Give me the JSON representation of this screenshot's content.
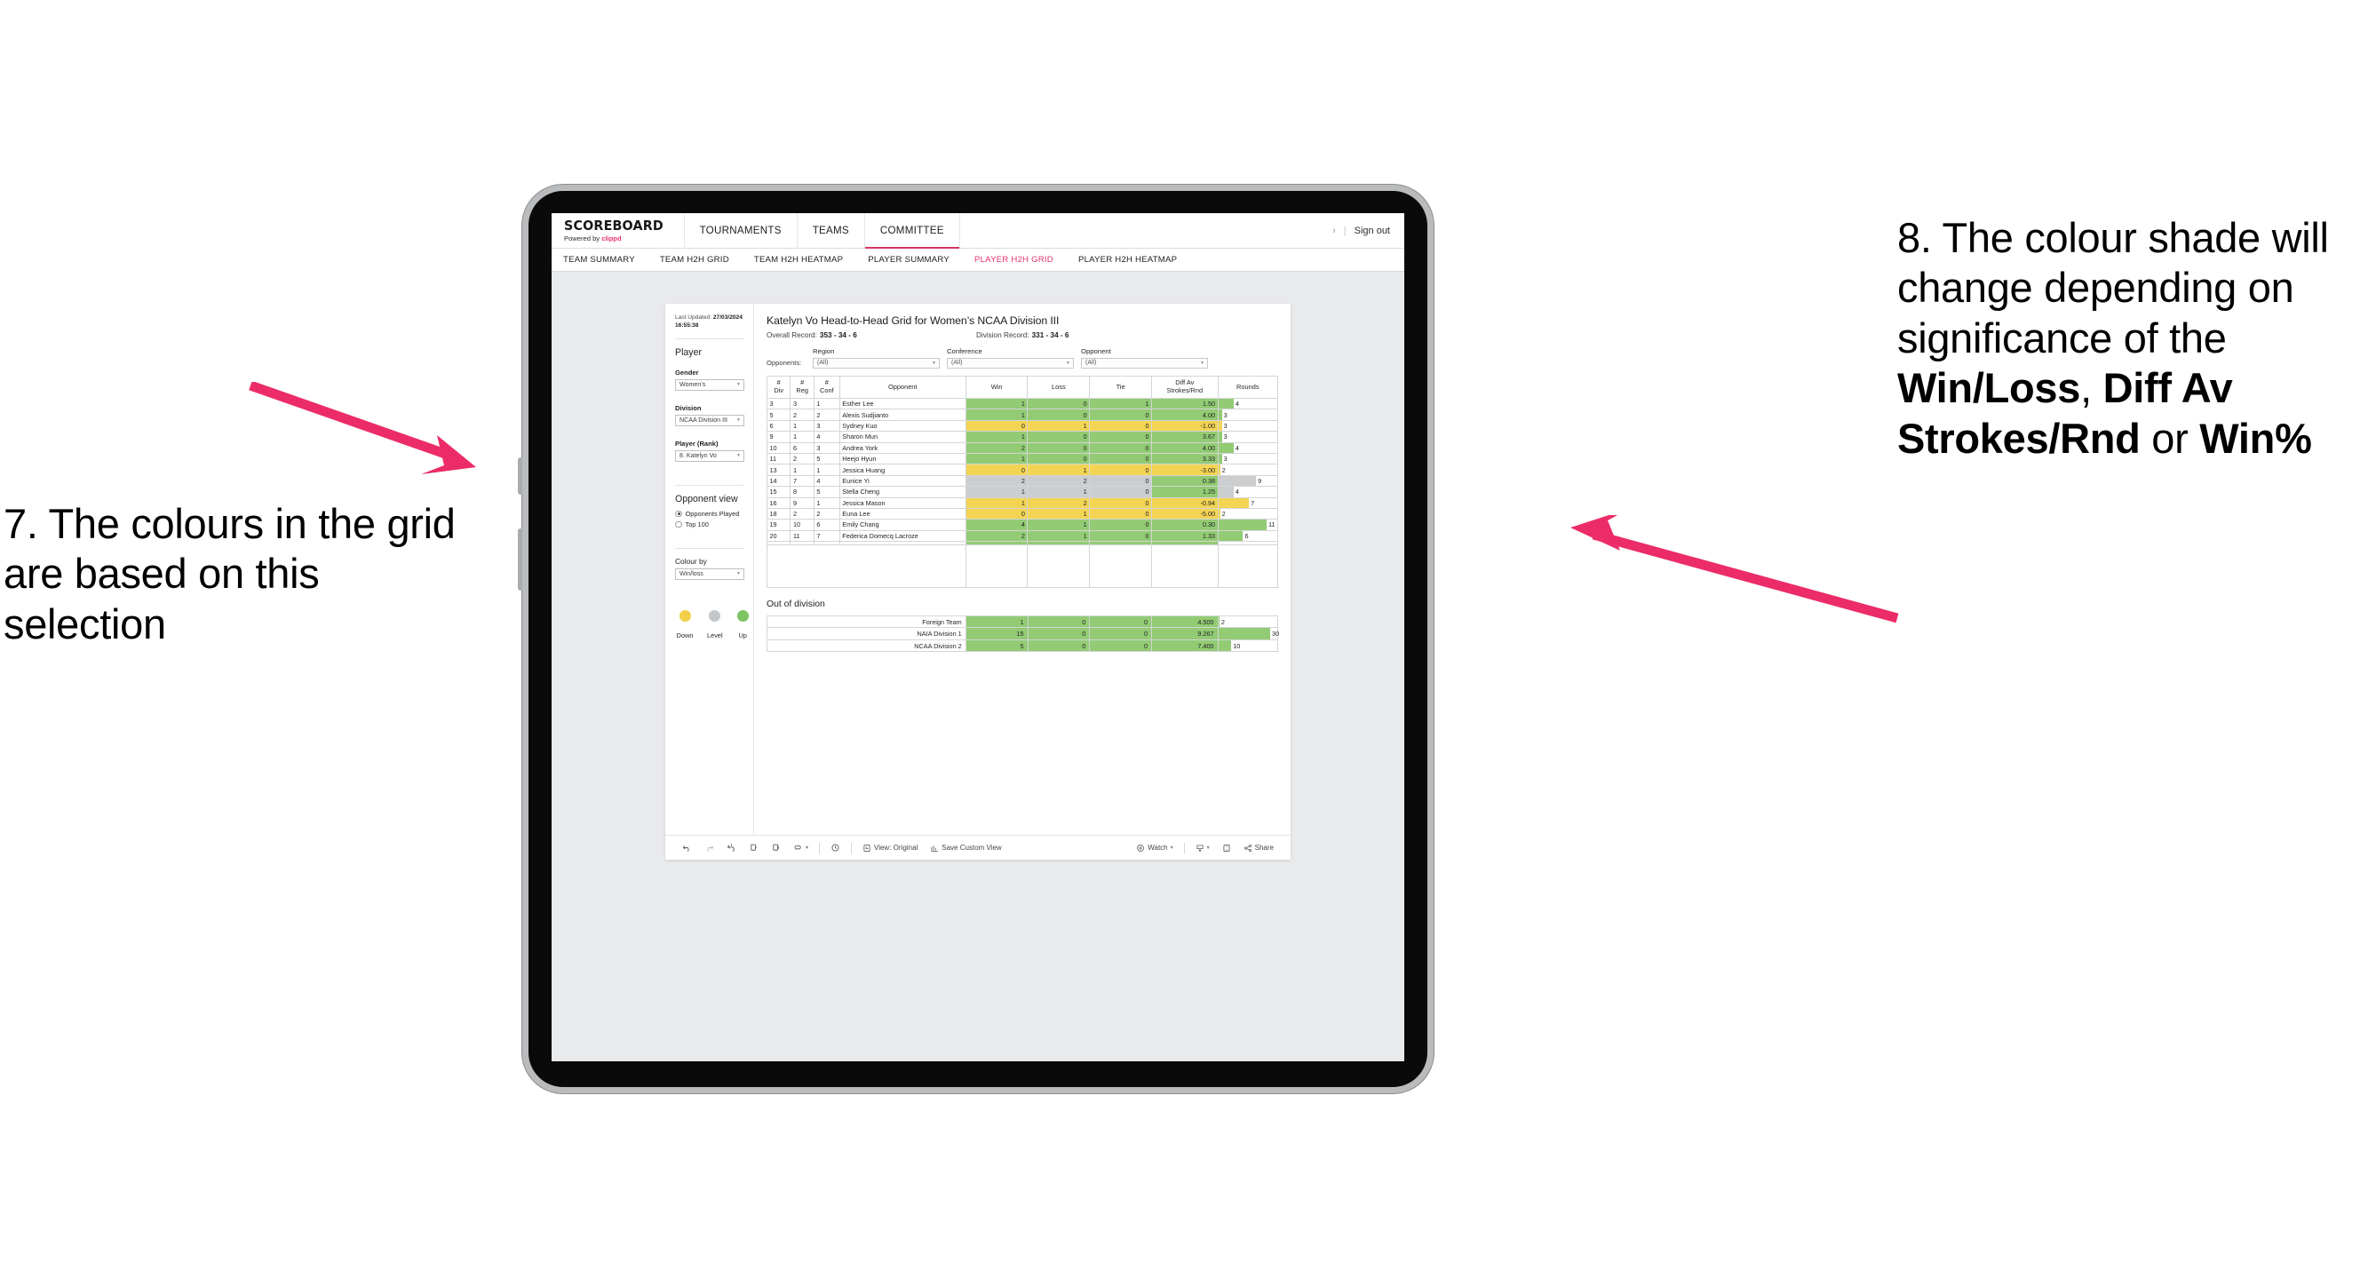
{
  "annotations": {
    "left": {
      "text": "7. The colours in the grid are based on this selection",
      "arrow_color": "#ec2c68"
    },
    "right": {
      "prefix": "8. The colour shade will change depending on significance of the ",
      "bold1": "Win/Loss",
      "mid1": ", ",
      "bold2": "Diff Av Strokes/Rnd",
      "mid2": " or ",
      "bold3": "Win%",
      "arrow_color": "#ec2c68"
    }
  },
  "header": {
    "logo": "SCOREBOARD",
    "powered_prefix": "Powered by ",
    "powered_brand": "clippd",
    "nav": [
      {
        "label": "TOURNAMENTS",
        "active": false
      },
      {
        "label": "TEAMS",
        "active": false
      },
      {
        "label": "COMMITTEE",
        "active": true
      }
    ],
    "chevron": "›",
    "divider": "|",
    "sign_out": "Sign out"
  },
  "subnav": [
    {
      "label": "TEAM SUMMARY",
      "active": false
    },
    {
      "label": "TEAM H2H GRID",
      "active": false
    },
    {
      "label": "TEAM H2H HEATMAP",
      "active": false
    },
    {
      "label": "PLAYER SUMMARY",
      "active": false
    },
    {
      "label": "PLAYER H2H GRID",
      "active": true
    },
    {
      "label": "PLAYER H2H HEATMAP",
      "active": false
    }
  ],
  "filters": {
    "last_updated_label": "Last Updated: ",
    "last_updated_value": "27/03/2024 16:55:38",
    "player_heading": "Player",
    "gender": {
      "label": "Gender",
      "value": "Women’s"
    },
    "division": {
      "label": "Division",
      "value": "NCAA Division III"
    },
    "player_rank": {
      "label": "Player (Rank)",
      "value": "8. Katelyn Vo"
    },
    "opponent_view": {
      "heading": "Opponent view",
      "options": [
        {
          "label": "Opponents Played",
          "selected": true
        },
        {
          "label": "Top 100",
          "selected": false
        }
      ]
    },
    "colour_by": {
      "label": "Colour by",
      "value": "Win/loss"
    },
    "legend": [
      {
        "label": "Down",
        "color": "#f2d04b"
      },
      {
        "label": "Level",
        "color": "#c3c7ca"
      },
      {
        "label": "Up",
        "color": "#7dc462"
      }
    ]
  },
  "main": {
    "title": "Katelyn Vo Head-to-Head Grid for Women’s NCAA Division III",
    "overall_record_label": "Overall Record:",
    "overall_record_value": "353 -  34 - 6",
    "division_record_label": "Division Record:",
    "division_record_value": "331 -  34 - 6",
    "opponents_label": "Opponents:",
    "opponent_filters": [
      {
        "title": "Region",
        "value": "(All)"
      },
      {
        "title": "Conference",
        "value": "(All)"
      },
      {
        "title": "Opponent",
        "value": "(All)"
      }
    ],
    "columns": [
      {
        "line1": "#",
        "line2": "Div"
      },
      {
        "line1": "#",
        "line2": "Reg"
      },
      {
        "line1": "#",
        "line2": "Conf"
      },
      {
        "line1": "Opponent",
        "line2": ""
      },
      {
        "line1": "Win",
        "line2": ""
      },
      {
        "line1": "Loss",
        "line2": ""
      },
      {
        "line1": "Tie",
        "line2": ""
      },
      {
        "line1": "Diff Av",
        "line2": "Strokes/Rnd"
      },
      {
        "line1": "Rounds",
        "line2": ""
      }
    ],
    "rows": [
      {
        "div": "3",
        "reg": "3",
        "conf": "1",
        "opponent": "Esther Lee",
        "win": "1",
        "loss": "0",
        "tie": "1",
        "diff": "1.50",
        "rounds": "4",
        "shade": "green",
        "bar": 26
      },
      {
        "div": "5",
        "reg": "2",
        "conf": "2",
        "opponent": "Alexis Sudjianto",
        "win": "1",
        "loss": "0",
        "tie": "0",
        "diff": "4.00",
        "rounds": "3",
        "shade": "green",
        "bar": 6
      },
      {
        "div": "6",
        "reg": "1",
        "conf": "3",
        "opponent": "Sydney Kuo",
        "win": "0",
        "loss": "1",
        "tie": "0",
        "diff": "-1.00",
        "rounds": "3",
        "shade": "yellow",
        "bar": 6
      },
      {
        "div": "9",
        "reg": "1",
        "conf": "4",
        "opponent": "Sharon Mun",
        "win": "1",
        "loss": "0",
        "tie": "0",
        "diff": "3.67",
        "rounds": "3",
        "shade": "green",
        "bar": 6
      },
      {
        "div": "10",
        "reg": "6",
        "conf": "3",
        "opponent": "Andrea York",
        "win": "2",
        "loss": "0",
        "tie": "0",
        "diff": "4.00",
        "rounds": "4",
        "shade": "green",
        "bar": 26
      },
      {
        "div": "11",
        "reg": "2",
        "conf": "5",
        "opponent": "Heejo Hyun",
        "win": "1",
        "loss": "0",
        "tie": "0",
        "diff": "3.33",
        "rounds": "3",
        "shade": "green",
        "bar": 6
      },
      {
        "div": "13",
        "reg": "1",
        "conf": "1",
        "opponent": "Jessica Huang",
        "win": "0",
        "loss": "1",
        "tie": "0",
        "diff": "-3.00",
        "rounds": "2",
        "shade": "yellow",
        "bar": 3
      },
      {
        "div": "14",
        "reg": "7",
        "conf": "4",
        "opponent": "Eunice Yi",
        "win": "2",
        "loss": "2",
        "tie": "0",
        "diff": "0.38",
        "rounds": "9",
        "shade": "grey",
        "bar": 64,
        "diffshade": "green"
      },
      {
        "div": "15",
        "reg": "8",
        "conf": "5",
        "opponent": "Stella Cheng",
        "win": "1",
        "loss": "1",
        "tie": "0",
        "diff": "1.25",
        "rounds": "4",
        "shade": "grey",
        "bar": 26,
        "diffshade": "green"
      },
      {
        "div": "16",
        "reg": "9",
        "conf": "1",
        "opponent": "Jessica Mason",
        "win": "1",
        "loss": "2",
        "tie": "0",
        "diff": "-0.94",
        "rounds": "7",
        "shade": "yellow",
        "bar": 52
      },
      {
        "div": "18",
        "reg": "2",
        "conf": "2",
        "opponent": "Euna Lee",
        "win": "0",
        "loss": "1",
        "tie": "0",
        "diff": "-5.00",
        "rounds": "2",
        "shade": "yellow",
        "bar": 3
      },
      {
        "div": "19",
        "reg": "10",
        "conf": "6",
        "opponent": "Emily Chang",
        "win": "4",
        "loss": "1",
        "tie": "0",
        "diff": "0.30",
        "rounds": "11",
        "shade": "green",
        "bar": 82
      },
      {
        "div": "20",
        "reg": "11",
        "conf": "7",
        "opponent": "Federica Domecq Lacroze",
        "win": "2",
        "loss": "1",
        "tie": "0",
        "diff": "1.33",
        "rounds": "6",
        "shade": "green",
        "bar": 42
      }
    ],
    "out_of_division": {
      "title": "Out of division",
      "rows": [
        {
          "name": "Foreign Team",
          "win": "1",
          "loss": "0",
          "tie": "0",
          "diff": "4.500",
          "rounds": "2",
          "shade": "green",
          "bar": 2
        },
        {
          "name": "NAIA Division 1",
          "win": "15",
          "loss": "0",
          "tie": "0",
          "diff": "9.267",
          "rounds": "30",
          "shade": "green",
          "bar": 88
        },
        {
          "name": "NCAA Division 2",
          "win": "5",
          "loss": "0",
          "tie": "0",
          "diff": "7.400",
          "rounds": "10",
          "shade": "green",
          "bar": 22
        }
      ]
    }
  },
  "toolbar": {
    "view_label": "View: Original",
    "save_label": "Save Custom View",
    "watch_label": "Watch",
    "share_label": "Share",
    "caret": "▾"
  }
}
